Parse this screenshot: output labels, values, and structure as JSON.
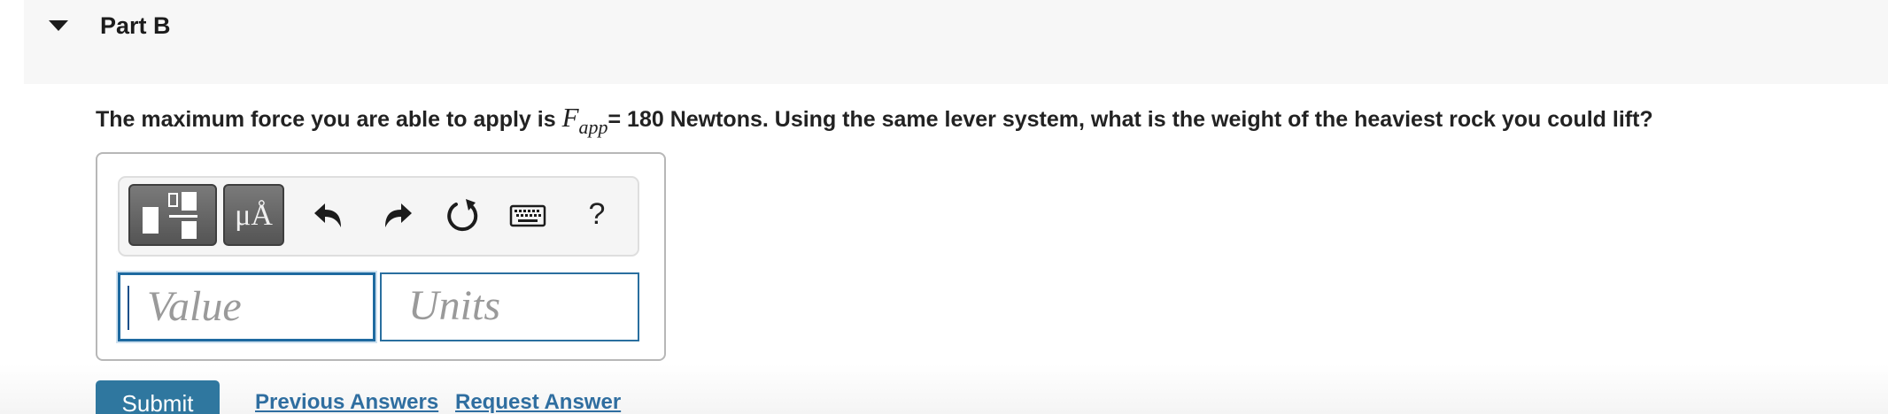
{
  "part": {
    "title": "Part B",
    "toggle_icon": "caret-down-icon"
  },
  "question": {
    "text_before": "The maximum force you are able to apply is ",
    "math_symbol": "F",
    "math_subscript": "app",
    "text_after": "= 180 Newtons.  Using the same lever system, what is the weight of the heaviest rock you could lift?"
  },
  "toolbar": {
    "templates_icon": "templates-icon",
    "units_label": "μÅ",
    "undo_icon": "undo-icon",
    "redo_icon": "redo-icon",
    "reset_icon": "reset-icon",
    "keyboard_icon": "keyboard-icon",
    "help_label": "?"
  },
  "answer": {
    "value_placeholder": "Value",
    "units_placeholder": "Units"
  },
  "actions": {
    "submit_label": "Submit",
    "previous_answers_label": "Previous Answers",
    "request_answer_label": "Request Answer"
  },
  "colors": {
    "accent": "#2f779f",
    "link": "#2f6ea0",
    "field_border": "#1e6aa0"
  }
}
